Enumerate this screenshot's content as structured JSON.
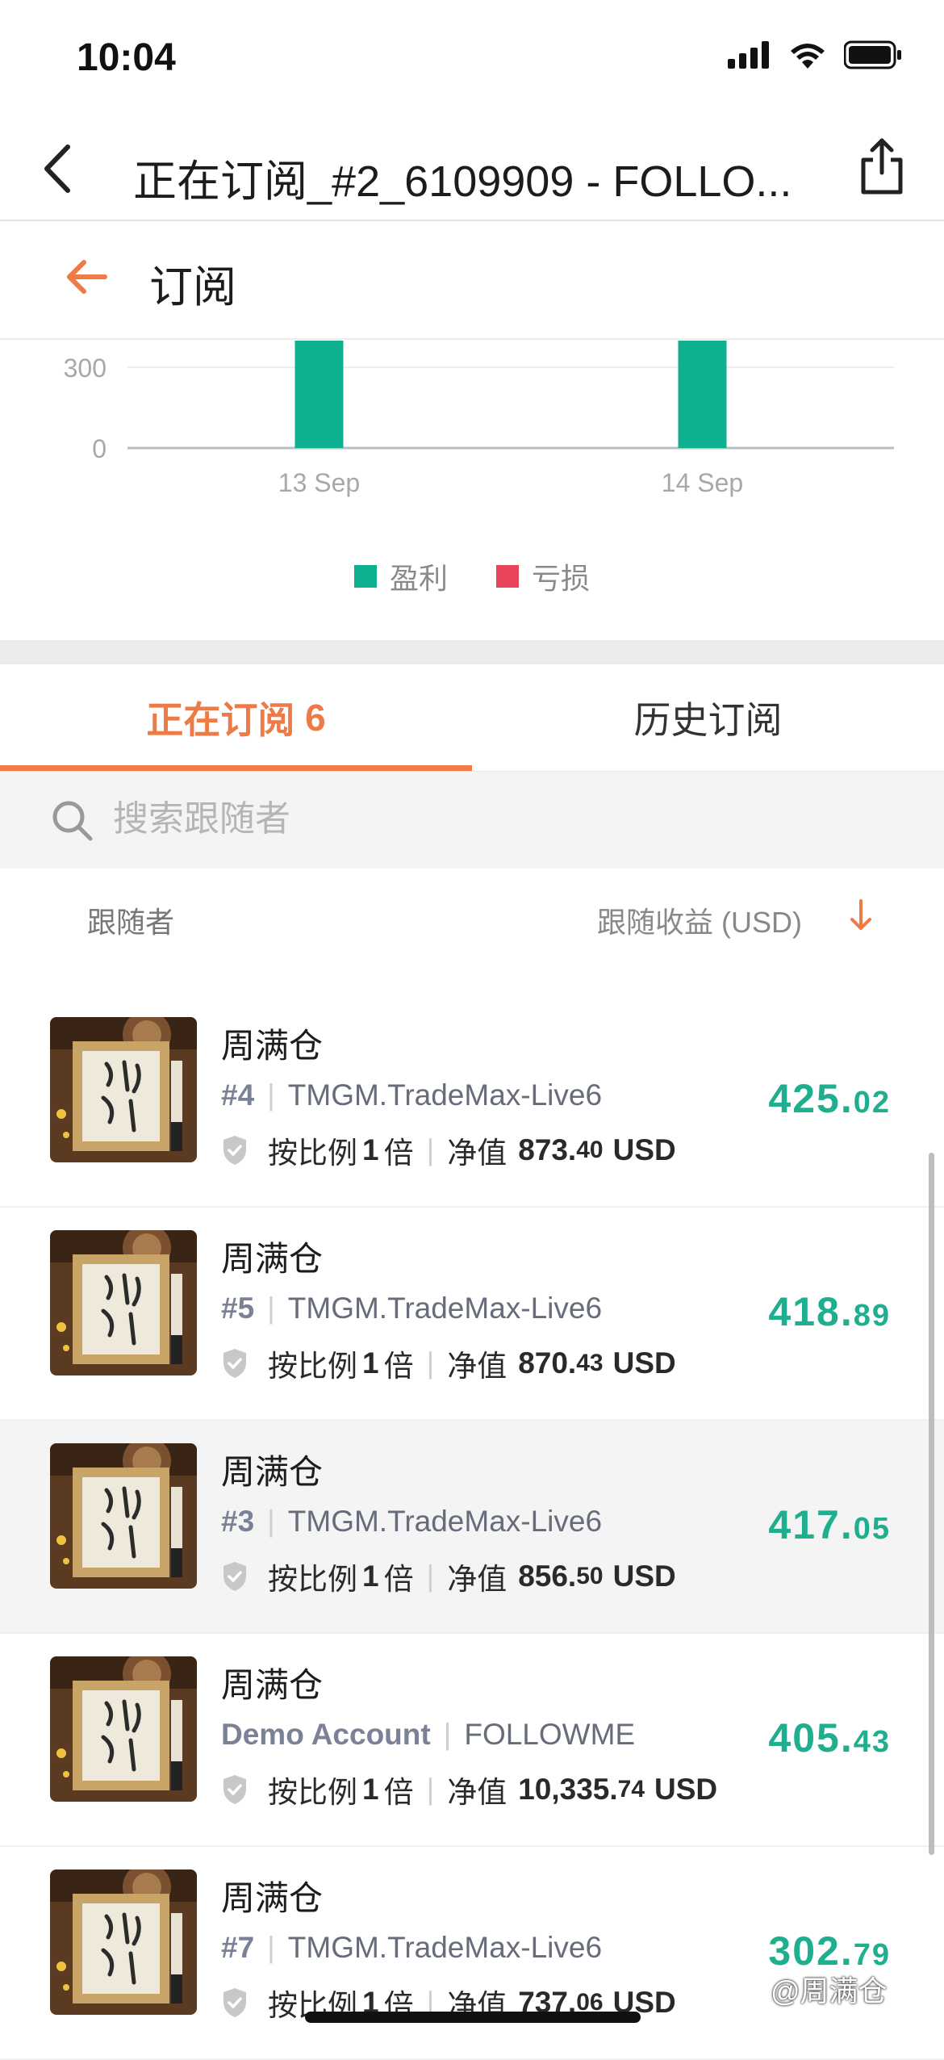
{
  "status_bar": {
    "time": "10:04"
  },
  "nav": {
    "title": "正在订阅_#2_6109909 - FOLLO..."
  },
  "subscribe_header": {
    "title": "订阅"
  },
  "chart_data": {
    "type": "bar",
    "categories": [
      "13 Sep",
      "14 Sep"
    ],
    "series": [
      {
        "name": "盈利",
        "values": [
          425,
          425
        ],
        "color": "#0fb08f"
      },
      {
        "name": "亏损",
        "values": [
          0,
          0
        ],
        "color": "#e8455b"
      }
    ],
    "y_ticks": [
      "0",
      "300"
    ],
    "ylim": [
      0,
      300
    ],
    "grid": true,
    "legend_position": "bottom-center"
  },
  "tabs": {
    "active_label": "正在订阅",
    "active_count": "6",
    "inactive_label": "历史订阅"
  },
  "search": {
    "placeholder": "搜索跟随者"
  },
  "columns": {
    "left": "跟随者",
    "right": "跟随收益 (USD)"
  },
  "colors": {
    "accent": "#ee7a45",
    "profit": "#1fae8e",
    "loss": "#e8455b"
  },
  "followers": [
    {
      "name": "周满仓",
      "account_id": "#4",
      "server": "TMGM.TradeMax-Live6",
      "ratio_prefix": "按比例",
      "ratio_value": "1",
      "ratio_suffix": "倍",
      "equity_label": "净值",
      "equity_int": "873.",
      "equity_dec": "40",
      "equity_unit": "USD",
      "profit_int": "425.",
      "profit_dec": "02"
    },
    {
      "name": "周满仓",
      "account_id": "#5",
      "server": "TMGM.TradeMax-Live6",
      "ratio_prefix": "按比例",
      "ratio_value": "1",
      "ratio_suffix": "倍",
      "equity_label": "净值",
      "equity_int": "870.",
      "equity_dec": "43",
      "equity_unit": "USD",
      "profit_int": "418.",
      "profit_dec": "89"
    },
    {
      "name": "周满仓",
      "account_id": "#3",
      "server": "TMGM.TradeMax-Live6",
      "ratio_prefix": "按比例",
      "ratio_value": "1",
      "ratio_suffix": "倍",
      "equity_label": "净值",
      "equity_int": "856.",
      "equity_dec": "50",
      "equity_unit": "USD",
      "profit_int": "417.",
      "profit_dec": "05"
    },
    {
      "name": "周满仓",
      "account_id": "Demo Account",
      "server": "FOLLOWME",
      "ratio_prefix": "按比例",
      "ratio_value": "1",
      "ratio_suffix": "倍",
      "equity_label": "净值",
      "equity_int": "10,335.",
      "equity_dec": "74",
      "equity_unit": "USD",
      "profit_int": "405.",
      "profit_dec": "43"
    },
    {
      "name": "周满仓",
      "account_id": "#7",
      "server": "TMGM.TradeMax-Live6",
      "ratio_prefix": "按比例",
      "ratio_value": "1",
      "ratio_suffix": "倍",
      "equity_label": "净值",
      "equity_int": "737.",
      "equity_dec": "06",
      "equity_unit": "USD",
      "profit_int": "302.",
      "profit_dec": "79"
    }
  ],
  "watermark": "@周满仓"
}
